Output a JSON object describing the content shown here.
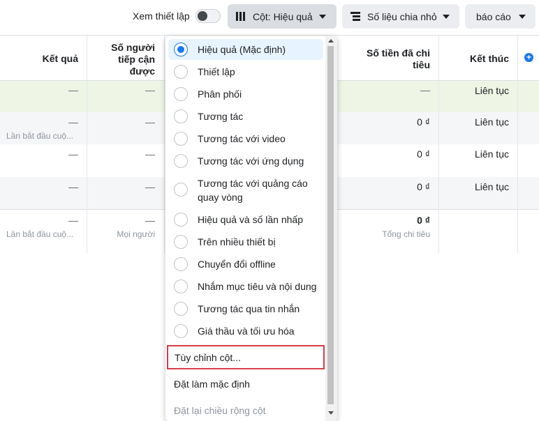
{
  "toolbar": {
    "setup_label": "Xem thiết lập",
    "columns_label": "Cột: Hiệu quả",
    "breakdown_label": "Số liệu chia nhỏ",
    "report_label": "báo cáo"
  },
  "table": {
    "headers": {
      "results": "Kết quả",
      "reach": "Số người tiếp cận được",
      "spent": "Số tiền đã chi tiêu",
      "end": "Kết thúc"
    },
    "rows": [
      {
        "results": "—",
        "results_sub": "",
        "reach": "—",
        "spent": "—",
        "end": "Liên tục"
      },
      {
        "results": "—",
        "results_sub": "Lần bắt đầu cuộ...",
        "reach": "—",
        "spent": "0 ₫",
        "end": "Liên tục"
      },
      {
        "results": "—",
        "results_sub": "",
        "reach": "—",
        "spent": "0 ₫",
        "end": "Liên tục"
      },
      {
        "results": "—",
        "results_sub": "",
        "reach": "—",
        "spent": "0 ₫",
        "end": "Liên tục"
      }
    ],
    "summary": {
      "results": "—",
      "results_sub": "Lần bắt đầu cuộ...",
      "reach": "—",
      "reach_sub": "Mọi người",
      "spent": "0 ₫",
      "spent_sub": "Tổng chi tiêu"
    }
  },
  "dropdown": {
    "options": [
      "Hiệu quả (Mặc định)",
      "Thiết lập",
      "Phân phối",
      "Tương tác",
      "Tương tác với video",
      "Tương tác với ứng dụng",
      "Tương tác với quảng cáo quay vòng",
      "Hiệu quả và số lần nhấp",
      "Trên nhiều thiết bị",
      "Chuyển đổi offline",
      "Nhắm mục tiêu và nội dung",
      "Tương tác qua tin nhắn",
      "Giá thầu và tối ưu hóa"
    ],
    "selected_index": 0,
    "customize_label": "Tùy chỉnh cột...",
    "set_default_label": "Đặt làm mặc định",
    "reset_width_label": "Đặt lại chiều rộng cột"
  },
  "colors": {
    "accent": "#1877f2",
    "highlight_border": "#d93b45",
    "selected_row": "#eef5e5"
  }
}
